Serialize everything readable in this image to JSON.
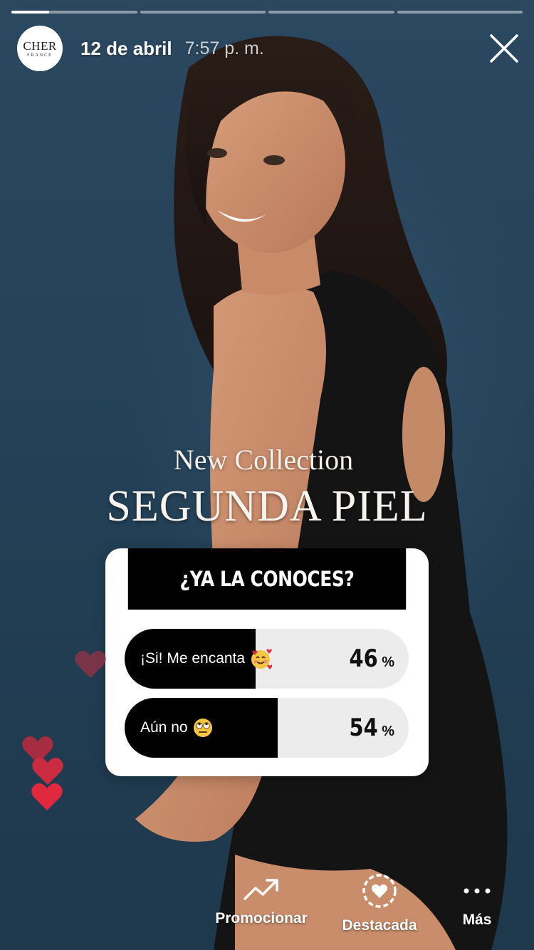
{
  "story": {
    "segments": [
      {
        "fill": 0.3
      },
      {
        "fill": 0
      },
      {
        "fill": 0
      },
      {
        "fill": 0
      }
    ]
  },
  "header": {
    "avatar_brand": "CHER",
    "avatar_sub": "FRANCE",
    "date": "12 de abril",
    "time": "7:57 p. m."
  },
  "overlay": {
    "subtitle": "New Collection",
    "title": "SEGUNDA PIEL"
  },
  "poll": {
    "question": "¿YA LA CONOCES?",
    "options": [
      {
        "label": "¡Si! Me encanta",
        "emoji": "smiling-face-with-hearts",
        "percent": 46
      },
      {
        "label": "Aún no",
        "emoji": "face-with-rolling-eyes",
        "percent": 54
      }
    ],
    "percent_sign": "%"
  },
  "bottom_bar": {
    "promote_label": "Promocionar",
    "highlight_label": "Destacada",
    "more_label": "Más"
  },
  "colors": {
    "background": "#244157",
    "heart_red": "#e0293e",
    "poll_bar": "#000000"
  }
}
